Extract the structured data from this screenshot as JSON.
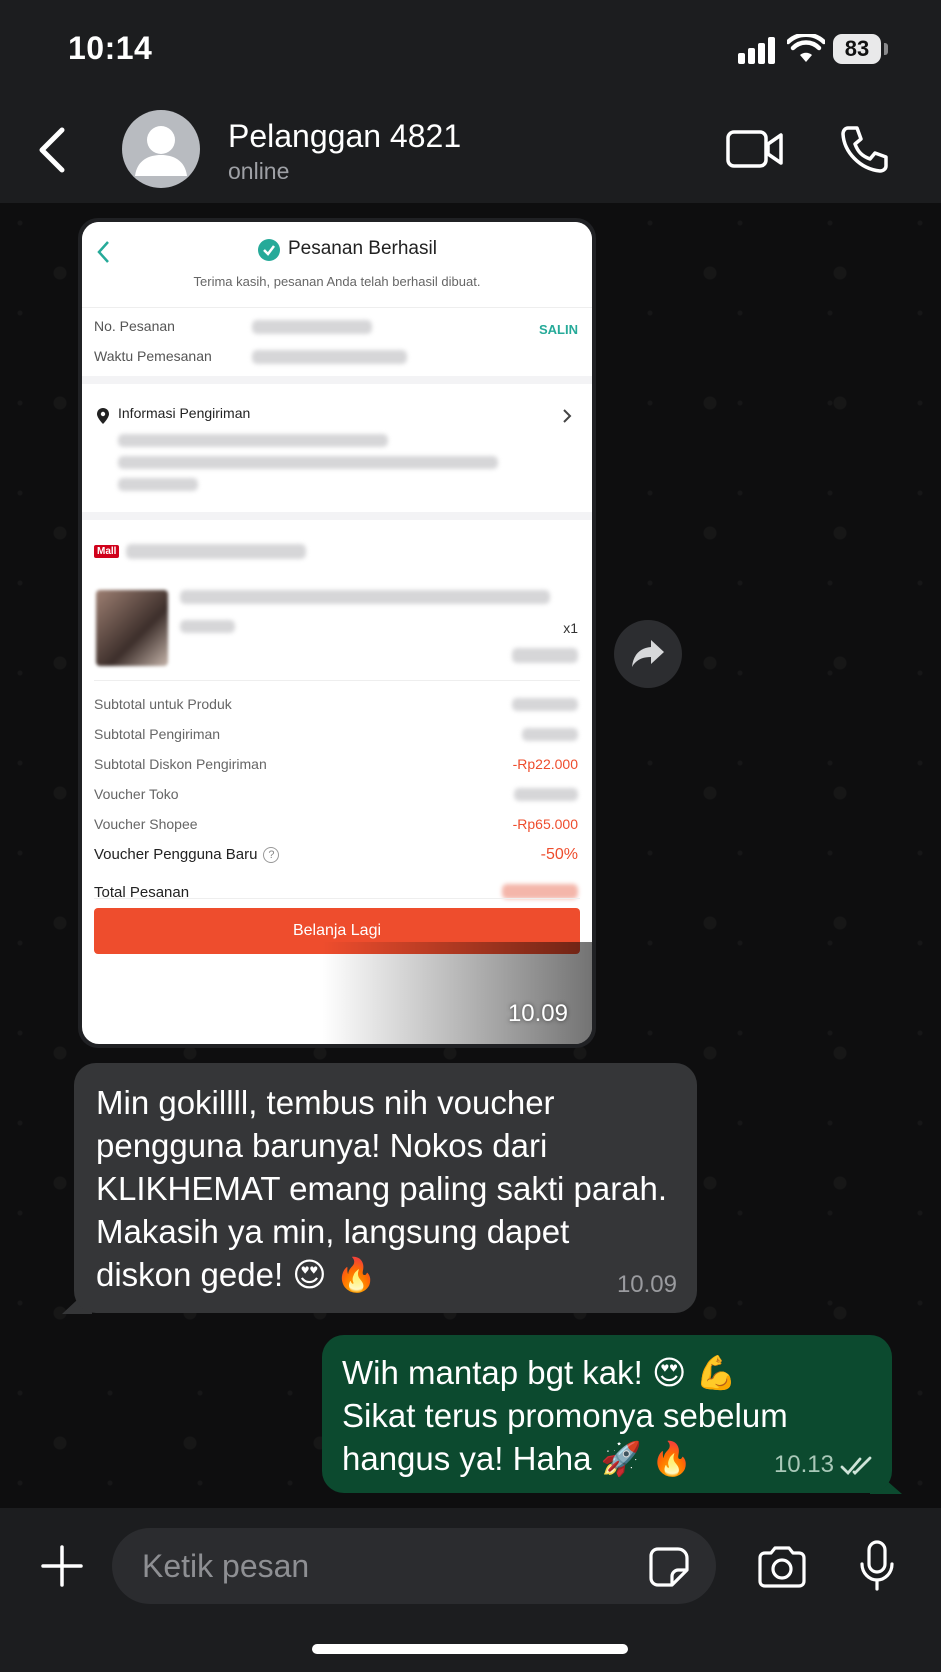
{
  "status_bar": {
    "time": "10:14",
    "battery": "83"
  },
  "header": {
    "contact_name": "Pelanggan 4821",
    "contact_status": "online"
  },
  "image_message": {
    "time": "10.09",
    "screenshot": {
      "title": "Pesanan Berhasil",
      "subtitle": "Terima kasih, pesanan Anda telah berhasil dibuat.",
      "order_no_label": "No. Pesanan",
      "copy_label": "SALIN",
      "order_time_label": "Waktu Pemesanan",
      "shipping_info_label": "Informasi Pengiriman",
      "mall_badge": "Mall",
      "quantity": "x1",
      "summary": [
        {
          "label": "Subtotal untuk Produk",
          "value": ""
        },
        {
          "label": "Subtotal Pengiriman",
          "value": ""
        },
        {
          "label": "Subtotal Diskon Pengiriman",
          "value": "-Rp22.000"
        },
        {
          "label": "Voucher Toko",
          "value": ""
        },
        {
          "label": "Voucher Shopee",
          "value": "-Rp65.000"
        }
      ],
      "new_user_voucher_label": "Voucher Pengguna Baru",
      "new_user_voucher_value": "-50%",
      "total_label": "Total Pesanan",
      "button_label": "Belanja Lagi"
    }
  },
  "incoming_message": {
    "text": "Min gokillll, tembus nih voucher\npengguna barunya! Nokos dari\nKLIKHEMAT emang paling sakti parah.\nMakasih ya min, langsung dapet\ndiskon gede! 😍 🔥",
    "time": "10.09"
  },
  "outgoing_message": {
    "text": "Wih mantap bgt kak! 😍 💪\nSikat terus promonya sebelum\nhangus ya! Haha 🚀 🔥",
    "time": "10.13"
  },
  "composer": {
    "placeholder": "Ketik pesan"
  },
  "colors": {
    "header_bg": "#1c1d1f",
    "outgoing_bubble": "#0c4a2f",
    "incoming_bubble": "#353638",
    "shopee_orange": "#ee4d2d",
    "success_green": "#26aa99"
  }
}
